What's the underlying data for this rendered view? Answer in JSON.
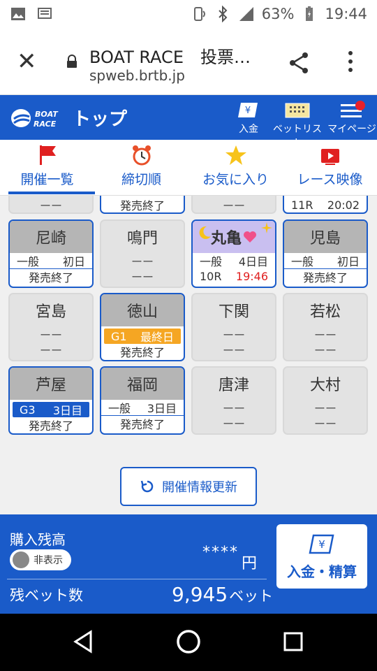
{
  "status_bar": {
    "battery_percent": "63%",
    "time": "19:44",
    "network": "4G"
  },
  "browser": {
    "close_label": "✕",
    "title": "BOAT RACE　投票…",
    "url": "spweb.brtb.jp"
  },
  "header": {
    "title": "トップ",
    "deposit_label": "入金",
    "betlist_label": "ベットリスト",
    "mypage_label": "マイページ"
  },
  "tabs": [
    {
      "label": "開催一覧",
      "icon": "flag-icon",
      "active": true
    },
    {
      "label": "締切順",
      "icon": "alarm-clock-icon",
      "active": false
    },
    {
      "label": "お気に入り",
      "icon": "star-icon",
      "active": false
    },
    {
      "label": "レース映像",
      "icon": "video-icon",
      "active": false
    }
  ],
  "partial_row": [
    {
      "line": "ーー"
    },
    {
      "line": "発売終了"
    },
    {
      "line": "ーー"
    },
    {
      "race": "11R",
      "time": "20:02"
    }
  ],
  "venues": [
    {
      "name": "尼崎",
      "grade": "一般",
      "day": "初日",
      "status": "発売終了"
    },
    {
      "name": "鳴門",
      "line1": "ーー",
      "line2": "ーー"
    },
    {
      "name": "丸亀",
      "grade": "一般",
      "day": "4日目",
      "race": "10R",
      "deadline": "19:46"
    },
    {
      "name": "児島",
      "grade": "一般",
      "day": "初日",
      "status": "発売終了"
    },
    {
      "name": "宮島",
      "line1": "ーー",
      "line2": "ーー"
    },
    {
      "name": "徳山",
      "grade": "G1",
      "day": "最終日",
      "status": "発売終了"
    },
    {
      "name": "下関",
      "line1": "ーー",
      "line2": "ーー"
    },
    {
      "name": "若松",
      "line1": "ーー",
      "line2": "ーー"
    },
    {
      "name": "芦屋",
      "grade": "G3",
      "day": "3日目",
      "status": "発売終了"
    },
    {
      "name": "福岡",
      "grade": "一般",
      "day": "3日目",
      "status": "発売終了"
    },
    {
      "name": "唐津",
      "line1": "ーー",
      "line2": "ーー"
    },
    {
      "name": "大村",
      "line1": "ーー",
      "line2": "ーー"
    }
  ],
  "refresh_label": "開催情報更新",
  "footer": {
    "balance_label": "購入残高",
    "toggle_label": "非表示",
    "balance_masked": "****",
    "yen": "円",
    "remaining_bets_label": "残ベット数",
    "remaining_bets": "9,945",
    "bets_unit": "ベット",
    "deposit_settle_label": "入金・精算"
  },
  "colors": {
    "brand": "#1a5bc9",
    "orange_grade": "#f5a623",
    "deadline_red": "#e02020",
    "night_purple": "#c9bff0"
  }
}
